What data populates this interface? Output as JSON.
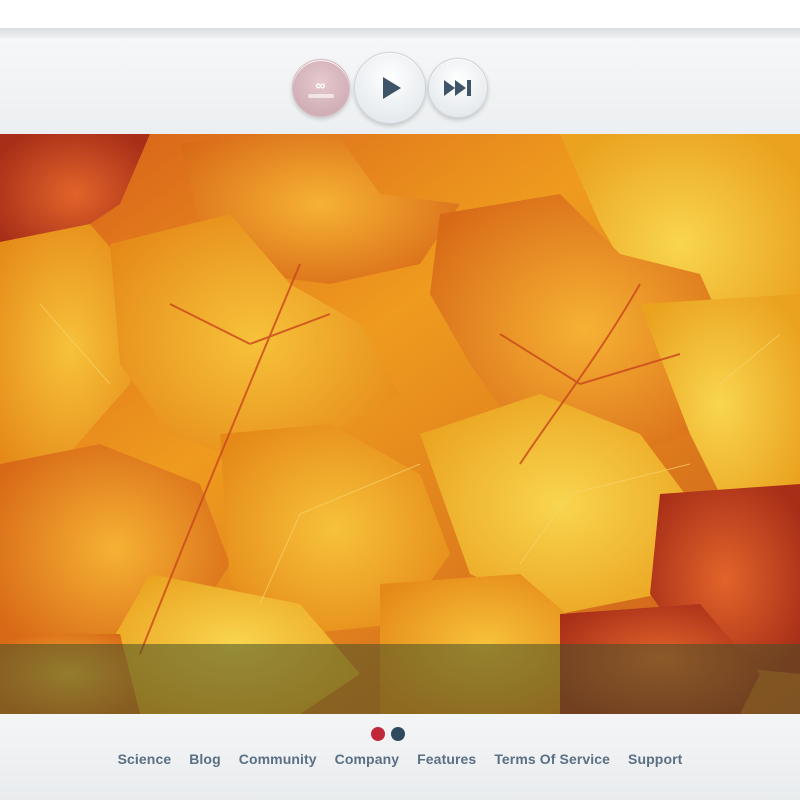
{
  "header": {
    "logo_mark": "∞",
    "colors": {
      "play_icon": "#3e5569",
      "next_icon": "#3e5569"
    },
    "controls": [
      {
        "name": "logo",
        "icon": "infinity-logo-icon"
      },
      {
        "name": "play",
        "icon": "play-icon"
      },
      {
        "name": "next",
        "icon": "skip-forward-icon"
      }
    ]
  },
  "hero": {
    "caption_band_color": "#46502899"
  },
  "pager": {
    "active_color": "#c0283a",
    "inactive_color": "#2f4a5e",
    "count": 2,
    "active_index": 0
  },
  "footer": {
    "nav": [
      {
        "label": "Science"
      },
      {
        "label": "Blog"
      },
      {
        "label": "Community"
      },
      {
        "label": "Company"
      },
      {
        "label": "Features"
      },
      {
        "label": "Terms Of Service"
      },
      {
        "label": "Support"
      }
    ]
  }
}
